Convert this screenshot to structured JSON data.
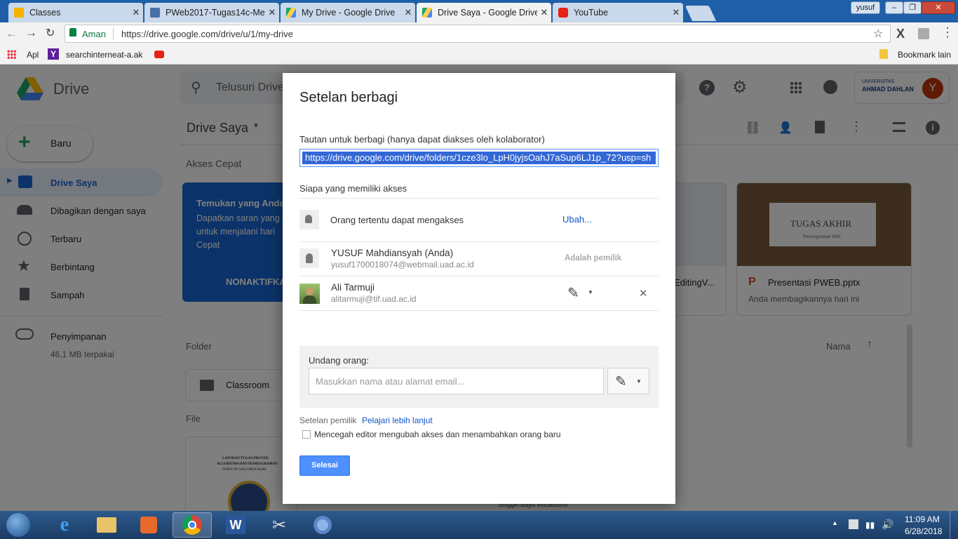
{
  "browser": {
    "tabs": [
      {
        "title": "Classes",
        "favicon_color": "#f4b400"
      },
      {
        "title": "PWeb2017-Tugas14c-Me",
        "favicon_color": "#4a6fa5"
      },
      {
        "title": "My Drive - Google Drive",
        "favicon_color": "#1fa463"
      },
      {
        "title": "Drive Saya - Google Drive",
        "favicon_color": "#1fa463"
      },
      {
        "title": "YouTube",
        "favicon_color": "#e62117"
      }
    ],
    "profile_name": "yusuf",
    "address": {
      "secure_label": "Aman",
      "url": "https://drive.google.com/drive/u/1/my-drive"
    },
    "bookmarks": {
      "apps_label": "Apl",
      "item1": "searchinterneat-a.ak",
      "other_label": "Bookmark lain"
    }
  },
  "drive": {
    "logo_text": "Drive",
    "search_placeholder": "Telusuri Drive",
    "new_button": "Baru",
    "page_title": "Drive Saya",
    "nav": [
      {
        "label": "Drive Saya",
        "icon": "my-drive-icon"
      },
      {
        "label": "Dibagikan dengan saya",
        "icon": "shared-icon"
      },
      {
        "label": "Terbaru",
        "icon": "clock-icon"
      },
      {
        "label": "Berbintang",
        "icon": "star-icon"
      },
      {
        "label": "Sampah",
        "icon": "trash-icon"
      }
    ],
    "storage_label": "Penyimpanan",
    "storage_used": "46,1 MB terpakai",
    "quick_access_label": "Akses Cepat",
    "promo": {
      "title": "Temukan yang Anda",
      "body": "Dapatkan saran yang untuk menjalani hari Cepat",
      "button": "NONAKTIFKA"
    },
    "card_file_mid": "EditingV...",
    "card_file": {
      "name": "Presentasi PWEB.pptx",
      "subtitle": "Anda membagikannya hari ini",
      "thumb_title": "TUGAS AKHIR",
      "thumb_sub": "Pemrograman Web"
    },
    "folder_section": "Folder",
    "sort_label": "Nama",
    "folder_name": "Classroom",
    "file_section": "File",
    "doc_thumb_lines": [
      "LAPORAN TUGAS PROYEK",
      "ALGORITMA DAN PEMROGRAMAN",
      "POINT OF SALE PROGRAM"
    ],
    "other_thumb_text": "Singgih Bayu Wicaksono",
    "university": {
      "line1": "UNIVERSITAS",
      "line2": "AHMAD DAHLAN"
    },
    "avatar_letter": "Y"
  },
  "dialog": {
    "title": "Setelan berbagi",
    "link_label": "Tautan untuk berbagi (hanya dapat diakses oleh kolaborator)",
    "link_value": "https://drive.google.com/drive/folders/1cze3lo_LpH0jyjsOahJ7aSup6LJ1p_72?usp=sh",
    "access_label": "Siapa yang memiliki akses",
    "access_row": {
      "text": "Orang tertentu dapat mengakses",
      "change": "Ubah..."
    },
    "people": [
      {
        "name": "YUSUF Mahdiansyah (Anda)",
        "email": "yusuf1700018074@webmail.uad.ac.id",
        "role": "Adalah pemilik"
      },
      {
        "name": "Ali Tarmuji",
        "email": "alitarmuji@tif.uad.ac.id"
      }
    ],
    "invite_label": "Undang orang:",
    "invite_placeholder": "Masukkan nama atau alamat email...",
    "owner_settings": "Setelan pemilik",
    "learn_more": "Pelajari lebih lanjut",
    "prevent_label": "Mencegah editor mengubah akses dan menambahkan orang baru",
    "prevent_checked": false,
    "done_button": "Selesai"
  },
  "taskbar": {
    "time": "11:09 AM",
    "date": "6/28/2018"
  }
}
